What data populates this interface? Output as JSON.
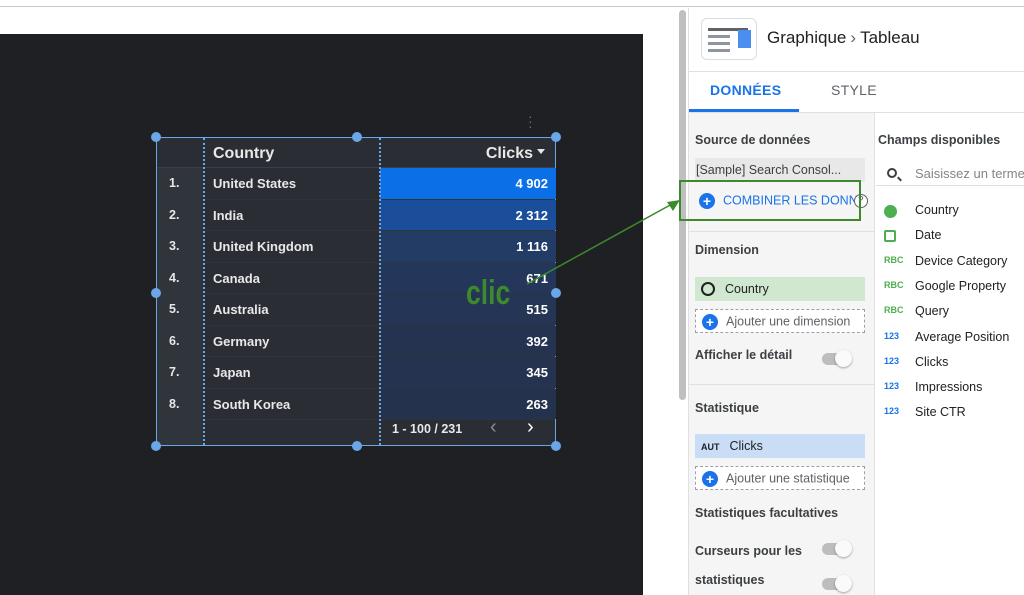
{
  "table": {
    "col_dimension": "Country",
    "col_metric": "Clicks",
    "rows": [
      {
        "idx": "1.",
        "country": "United States",
        "clicks": "4 902",
        "bar_color": "#0b6fe8"
      },
      {
        "idx": "2.",
        "country": "India",
        "clicks": "2 312",
        "bar_color": "#1a4e9a"
      },
      {
        "idx": "3.",
        "country": "United Kingdom",
        "clicks": "1 116",
        "bar_color": "#223c66"
      },
      {
        "idx": "4.",
        "country": "Canada",
        "clicks": "671",
        "bar_color": "#24375a"
      },
      {
        "idx": "5.",
        "country": "Australia",
        "clicks": "515",
        "bar_color": "#243555"
      },
      {
        "idx": "6.",
        "country": "Germany",
        "clicks": "392",
        "bar_color": "#253350"
      },
      {
        "idx": "7.",
        "country": "Japan",
        "clicks": "345",
        "bar_color": "#253350"
      },
      {
        "idx": "8.",
        "country": "South Korea",
        "clicks": "263",
        "bar_color": "#25324e"
      }
    ],
    "pagination": "1 - 100 / 231",
    "prev_icon": "‹",
    "next_icon": "›"
  },
  "annotation": {
    "text": "clic",
    "color": "#3d8a2e"
  },
  "panel": {
    "breadcrumb_chart": "Graphique",
    "breadcrumb_sep": "›",
    "breadcrumb_type": "Tableau",
    "tab_data": "DONNÉES",
    "tab_style": "STYLE",
    "source_label": "Source de données",
    "source_value": "[Sample] Search Consol...",
    "combine_label": "COMBINER LES DONN",
    "help_icon": "?",
    "dimension_label": "Dimension",
    "dimension_value": "Country",
    "add_dimension": "Ajouter une dimension",
    "show_detail": "Afficher le détail",
    "metric_label": "Statistique",
    "metric_badge": "AUT",
    "metric_value": "Clicks",
    "add_metric": "Ajouter une statistique",
    "optional_metrics": "Statistiques facultatives",
    "metric_sliders_line1": "Curseurs pour les",
    "metric_sliders_line2": "statistiques",
    "plus": "+",
    "available_fields": "Champs disponibles",
    "search_placeholder": "Saisissez un terme",
    "fields": [
      {
        "type": "geo",
        "icon_text": "",
        "name": "Country"
      },
      {
        "type": "date",
        "icon_text": "",
        "name": "Date"
      },
      {
        "type": "abc",
        "icon_text": "RBC",
        "name": "Device Category"
      },
      {
        "type": "abc",
        "icon_text": "RBC",
        "name": "Google Property"
      },
      {
        "type": "abc",
        "icon_text": "RBC",
        "name": "Query"
      },
      {
        "type": "num",
        "icon_text": "123",
        "name": "Average Position"
      },
      {
        "type": "num",
        "icon_text": "123",
        "name": "Clicks"
      },
      {
        "type": "num",
        "icon_text": "123",
        "name": "Impressions"
      },
      {
        "type": "num",
        "icon_text": "123",
        "name": "Site CTR"
      }
    ]
  }
}
